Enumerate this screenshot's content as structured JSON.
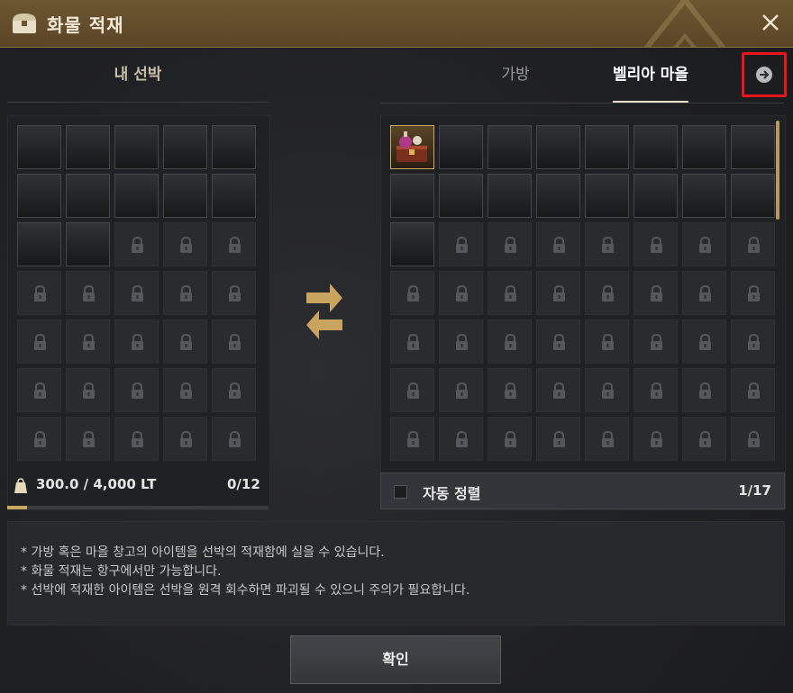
{
  "window": {
    "title": "화물 적재",
    "title_icon": "chest-icon",
    "close_icon": "close-icon"
  },
  "left": {
    "header": "내 선박",
    "open_slots": 12,
    "total_slots": 35,
    "weight_icon": "weight-icon",
    "weight_text": "300.0 / 4,000 LT",
    "weight_fill_fraction": 0.075,
    "count": "0/12"
  },
  "right": {
    "tabs": [
      {
        "label": "가방",
        "active": false
      },
      {
        "label": "벨리아 마을",
        "active": true
      }
    ],
    "next_icon": "arrow-right-circle-icon",
    "open_slots": 17,
    "total_slots": 56,
    "item_icon": "potion-chest-icon",
    "auto_sort_label": "자동 정렬",
    "count": "1/17"
  },
  "transfer_icon": "swap-arrows-icon",
  "notice": [
    "* 가방 혹은 마을 창고의 아이템을 선박의 적재함에 실을 수 있습니다.",
    "* 화물 적재는 항구에서만 가능합니다.",
    "* 선박에 적재한 아이템은 선박을 원격 회수하면 파괴될 수 있으니 주의가 필요합니다."
  ],
  "confirm_label": "확인",
  "colors": {
    "title_bar": "#6d5631",
    "accent_gold": "#c8a760",
    "highlight_red": "#e8141e"
  }
}
